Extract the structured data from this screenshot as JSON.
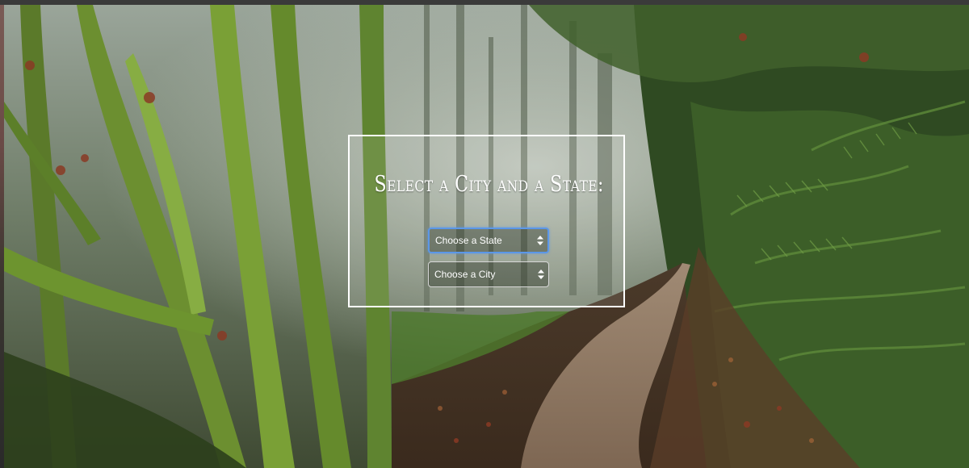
{
  "heading": "Select a City and a State:",
  "state_select": {
    "selected": "Choose a State",
    "icon": "select-arrows-icon"
  },
  "city_select": {
    "selected": "Choose a City",
    "icon": "select-arrows-icon"
  },
  "colors": {
    "frame_border": "#ffffff",
    "focus_ring": "#5b97e8",
    "text": "#ffffff"
  }
}
